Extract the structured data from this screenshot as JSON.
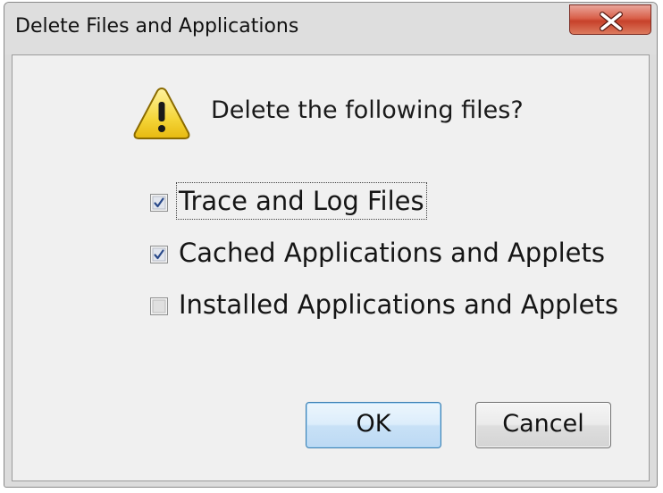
{
  "window": {
    "title": "Delete Files and Applications"
  },
  "dialog": {
    "question": "Delete the following files?",
    "icon": "warning-icon",
    "options": [
      {
        "label": "Trace and Log Files",
        "checked": true,
        "focused": true
      },
      {
        "label": "Cached Applications and Applets",
        "checked": true,
        "focused": false
      },
      {
        "label": "Installed Applications and Applets",
        "checked": false,
        "focused": false
      }
    ],
    "buttons": {
      "ok_label": "OK",
      "cancel_label": "Cancel"
    }
  },
  "colors": {
    "close_button": "#c7412a",
    "warning_fill": "#f5d63a",
    "default_button_border": "#3c7fb1"
  }
}
